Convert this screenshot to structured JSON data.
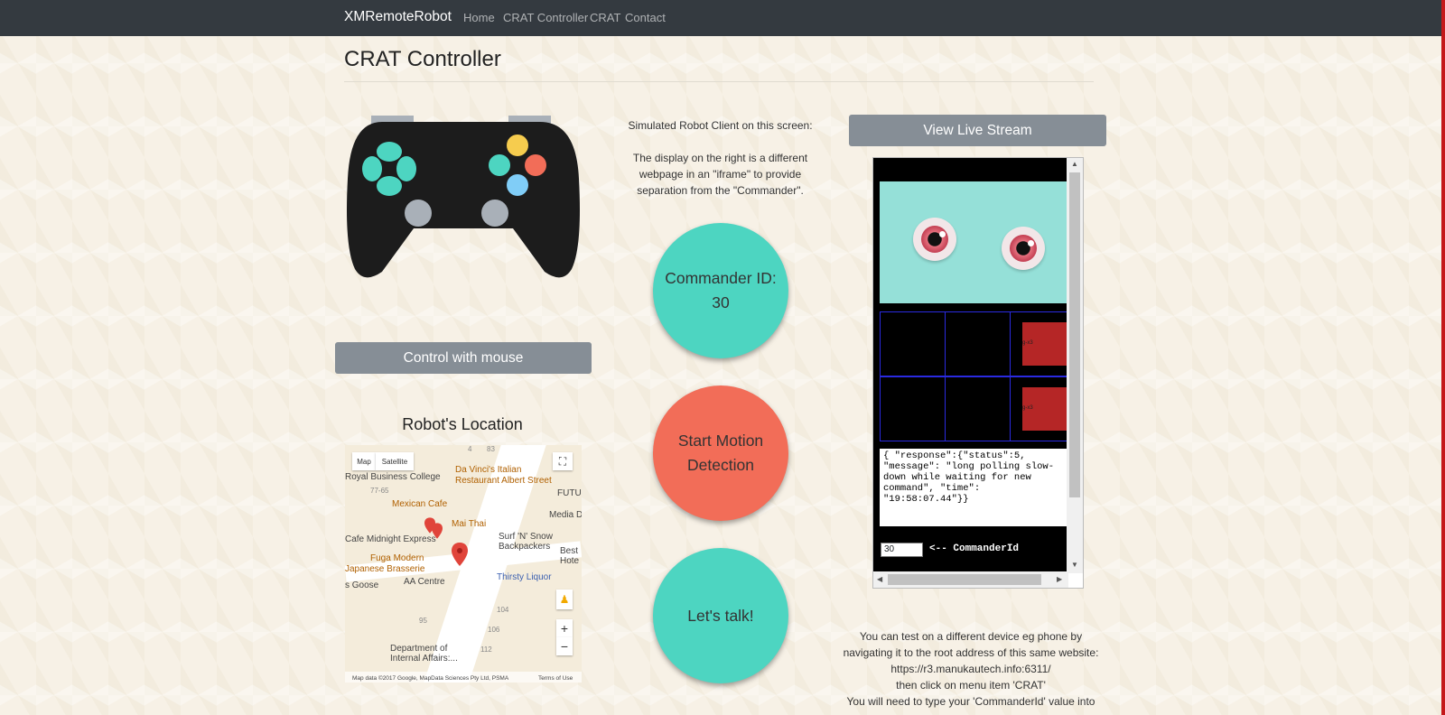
{
  "navbar": {
    "brand": "XMRemoteRobot",
    "links": [
      "Home",
      "CRAT Controller",
      "CRAT",
      "Contact"
    ]
  },
  "page": {
    "title": "CRAT Controller"
  },
  "left": {
    "control_button": "Control with mouse",
    "location_title": "Robot's Location"
  },
  "map": {
    "type_buttons": [
      "Map",
      "Satellite"
    ],
    "labels": [
      "Royal Business College",
      "Da Vinci's Italian",
      "Restaurant Albert Street",
      "Mexican Cafe",
      "FUTU",
      "Media D",
      "Mai Thai",
      "Cafe Midnight Express",
      "Surf 'N' Snow",
      "Backpackers",
      "Best",
      "Hote",
      "Fuga Modern",
      "Japanese Brasserie",
      "Thirsty Liquor",
      "s Goose",
      "AA Centre",
      "Department of",
      "Internal Affairs:..."
    ],
    "numbers": [
      "4",
      "83",
      "77-65",
      "95",
      "104",
      "106",
      "112"
    ],
    "attribution": "Map data ©2017 Google, MapData Sciences Pty Ltd, PSMA",
    "terms": "Terms of Use",
    "zoom_in": "+",
    "zoom_out": "−"
  },
  "middle": {
    "sim_line1": "Simulated Robot Client on this screen:",
    "sim_line2": "The display on the right is a different webpage in an \"iframe\" to provide separation from the \"Commander\".",
    "commander_id": "Commander ID: 30",
    "motion_button": "Start Motion Detection",
    "talk_button": "Let's talk!"
  },
  "right": {
    "live_stream_button": "View Live Stream",
    "grid_label": "g-x3",
    "response_text": "{ \"response\":{\"status\":5,\n\"message\": \"long polling slow-\ndown while waiting for new\ncommand\", \"time\":\n\"19:58:07.44\"}}",
    "commander_input_value": "30",
    "commander_label": "<-- CommanderId",
    "info_lines": [
      "You can test on a different device eg phone by",
      "navigating it to the root address of this same website:",
      "https://r3.manukautech.info:6311/",
      "then click on menu item 'CRAT'",
      "You will need to type your 'CommanderId' value into"
    ]
  },
  "colors": {
    "navbar": "#343a40",
    "teal": "#4dd5c1",
    "coral": "#f26d58",
    "gray_button": "#868e96"
  }
}
